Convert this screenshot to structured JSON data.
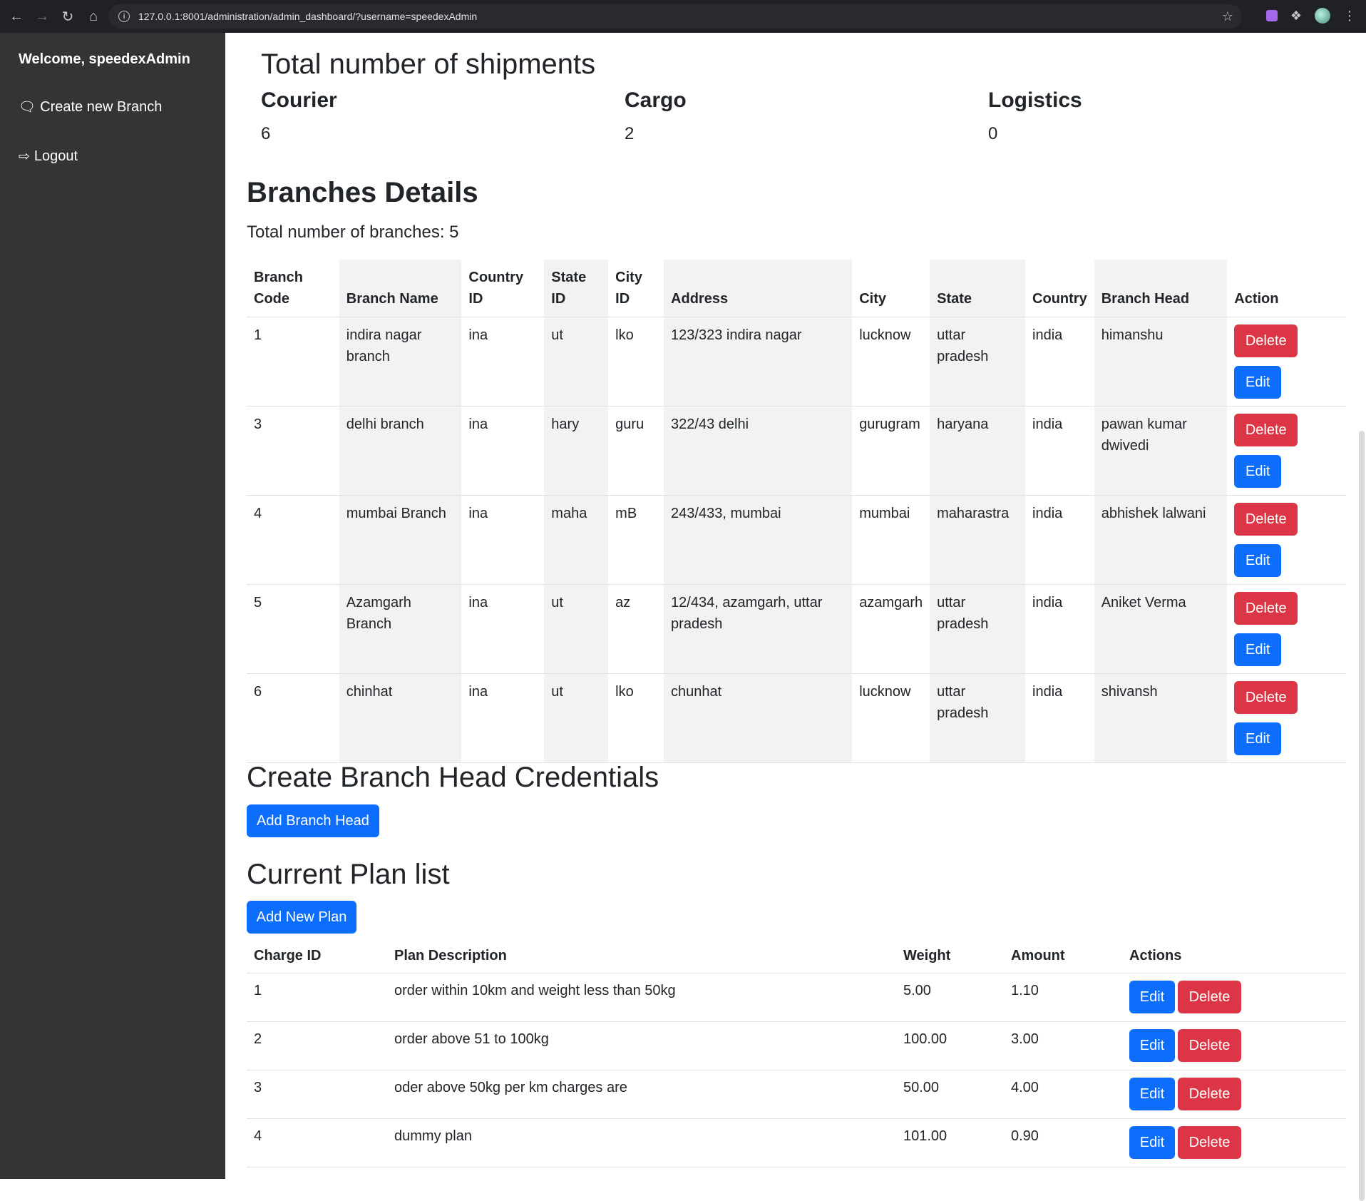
{
  "browser": {
    "url": "127.0.0.1:8001/administration/admin_dashboard/?username=speedexAdmin"
  },
  "sidebar": {
    "welcome": "Welcome, speedexAdmin",
    "create_branch": "Create new Branch",
    "logout": "Logout"
  },
  "shipments": {
    "title": "Total number of shipments",
    "courier_label": "Courier",
    "courier_value": "6",
    "cargo_label": "Cargo",
    "cargo_value": "2",
    "logistics_label": "Logistics",
    "logistics_value": "0"
  },
  "branches": {
    "title": "Branches Details",
    "total_text": "Total number of branches: 5",
    "headers": {
      "code_1": "Branch",
      "code_2": "Code",
      "name": "Branch Name",
      "country_id_1": "Country",
      "country_id_2": "ID",
      "state_id_1": "State",
      "state_id_2": "ID",
      "city_id_1": "City",
      "city_id_2": "ID",
      "address": "Address",
      "city": "City",
      "state": "State",
      "country": "Country",
      "head": "Branch Head",
      "action": "Action"
    },
    "delete_label": "Delete",
    "edit_label": "Edit",
    "rows": [
      {
        "code": "1",
        "name": "indira nagar branch",
        "country_id": "ina",
        "state_id": "ut",
        "city_id": "lko",
        "address": "123/323 indira nagar",
        "city": "lucknow",
        "state": "uttar pradesh",
        "country": "india",
        "head": "himanshu"
      },
      {
        "code": "3",
        "name": "delhi branch",
        "country_id": "ina",
        "state_id": "hary",
        "city_id": "guru",
        "address": "322/43 delhi",
        "city": "gurugram",
        "state": "haryana",
        "country": "india",
        "head": "pawan kumar dwivedi"
      },
      {
        "code": "4",
        "name": "mumbai Branch",
        "country_id": "ina",
        "state_id": "maha",
        "city_id": "mB",
        "address": "243/433, mumbai",
        "city": "mumbai",
        "state": "maharastra",
        "country": "india",
        "head": "abhishek lalwani"
      },
      {
        "code": "5",
        "name": "Azamgarh Branch",
        "country_id": "ina",
        "state_id": "ut",
        "city_id": "az",
        "address": "12/434, azamgarh, uttar pradesh",
        "city": "azamgarh",
        "state": "uttar pradesh",
        "country": "india",
        "head": "Aniket Verma"
      },
      {
        "code": "6",
        "name": "chinhat",
        "country_id": "ina",
        "state_id": "ut",
        "city_id": "lko",
        "address": "chunhat",
        "city": "lucknow",
        "state": "uttar pradesh",
        "country": "india",
        "head": "shivansh"
      }
    ]
  },
  "credentials": {
    "title": "Create Branch Head Credentials",
    "add_button": "Add Branch Head"
  },
  "plans": {
    "title": "Current Plan list",
    "add_button": "Add New Plan",
    "headers": {
      "charge_id": "Charge ID",
      "description": "Plan Description",
      "weight": "Weight",
      "amount": "Amount",
      "actions": "Actions"
    },
    "edit_label": "Edit",
    "delete_label": "Delete",
    "rows": [
      {
        "id": "1",
        "description": "order within 10km and weight less than 50kg",
        "weight": "5.00",
        "amount": "1.10"
      },
      {
        "id": "2",
        "description": "order above 51 to 100kg",
        "weight": "100.00",
        "amount": "3.00"
      },
      {
        "id": "3",
        "description": "oder above 50kg per km charges are",
        "weight": "50.00",
        "amount": "4.00"
      },
      {
        "id": "4",
        "description": "dummy plan",
        "weight": "101.00",
        "amount": "0.90"
      }
    ]
  }
}
